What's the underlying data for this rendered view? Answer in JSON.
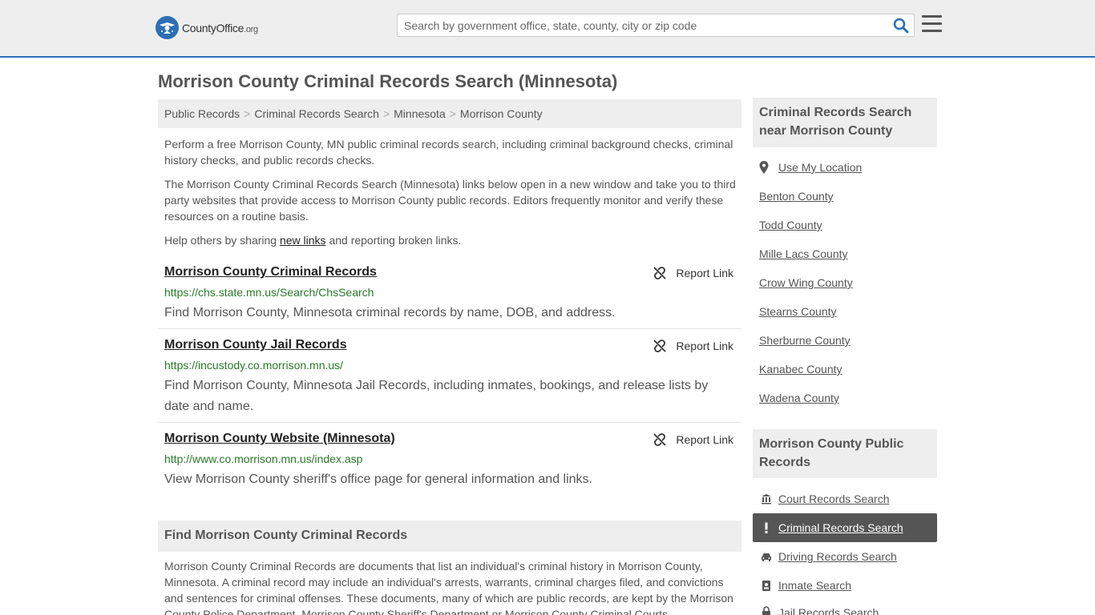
{
  "brand": {
    "name_part1": "County",
    "name_part2": "Office",
    "tld": ".org"
  },
  "search": {
    "placeholder": "Search by government office, state, county, city or zip code"
  },
  "page": {
    "title": "Morrison County Criminal Records Search (Minnesota)"
  },
  "breadcrumb": [
    "Public Records",
    "Criminal Records Search",
    "Minnesota",
    "Morrison County"
  ],
  "intro": {
    "p1": "Perform a free Morrison County, MN public criminal records search, including criminal background checks, criminal history checks, and public records checks.",
    "p2": "The Morrison County Criminal Records Search (Minnesota) links below open in a new window and take you to third party websites that provide access to Morrison County public records. Editors frequently monitor and verify these resources on a routine basis.",
    "p3_before": "Help others by sharing ",
    "p3_link": "new links",
    "p3_after": " and reporting broken links."
  },
  "report_label": "Report Link",
  "records": [
    {
      "title": "Morrison County Criminal Records",
      "url": "https://chs.state.mn.us/Search/ChsSearch",
      "desc": "Find Morrison County, Minnesota criminal records by name, DOB, and address."
    },
    {
      "title": "Morrison County Jail Records",
      "url": "https://incustody.co.morrison.mn.us/",
      "desc": "Find Morrison County, Minnesota Jail Records, including inmates, bookings, and release lists by date and name."
    },
    {
      "title": "Morrison County Website (Minnesota)",
      "url": "http://www.co.morrison.mn.us/index.asp",
      "desc": "View Morrison County sheriff's office page for general information and links."
    }
  ],
  "find_section": {
    "title": "Find Morrison County Criminal Records",
    "body": "Morrison County Criminal Records are documents that list an individual's criminal history in Morrison County, Minnesota. A criminal record may include an individual's arrests, warrants, criminal charges filed, and convictions and sentences for criminal offenses. These documents, many of which are public records, are kept by the Morrison County Police Department, Morrison County Sheriff's Department or Morrison County Criminal Courts."
  },
  "sidebar": {
    "nearby_title": "Criminal Records Search near Morrison County",
    "use_location": "Use My Location",
    "nearby": [
      "Benton County",
      "Todd County",
      "Mille Lacs County",
      "Crow Wing County",
      "Stearns County",
      "Sherburne County",
      "Kanabec County",
      "Wadena County"
    ],
    "public_title": "Morrison County Public Records",
    "public_items": [
      {
        "label": "Court Records Search",
        "icon": "courthouse-icon",
        "active": false
      },
      {
        "label": "Criminal Records Search",
        "icon": "exclamation-icon",
        "active": true
      },
      {
        "label": "Driving Records Search",
        "icon": "car-icon",
        "active": false
      },
      {
        "label": "Inmate Search",
        "icon": "id-badge-icon",
        "active": false
      },
      {
        "label": "Jail Records Search",
        "icon": "lock-icon",
        "active": false
      }
    ]
  },
  "colors": {
    "accent": "#2d6fb5",
    "url_green": "#2a7a2a",
    "active_bg": "#555555"
  }
}
